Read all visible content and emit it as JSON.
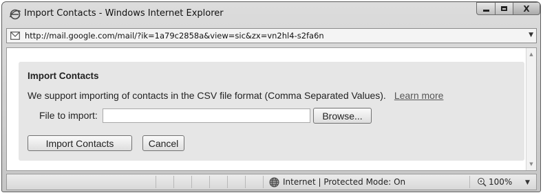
{
  "window": {
    "title": "Import Contacts - Windows Internet Explorer",
    "controls": {
      "minimize_icon": "minimize-icon",
      "maximize_icon": "maximize-icon",
      "close_icon": "close-icon",
      "close_glyph": "X"
    }
  },
  "addressbar": {
    "icon": "mail-icon",
    "url": "http://mail.google.com/mail/?ik=1a79c2858a&view=sic&zx=vn2hl4-s2fa6n",
    "dropdown_glyph": "▼"
  },
  "dialog": {
    "title": "Import Contacts",
    "description": "We support importing of contacts in the CSV file format (Comma Separated Values).",
    "learn_more": "Learn more",
    "file_label": "File to import:",
    "file_value": "",
    "browse_label": "Browse...",
    "import_label": "Import Contacts",
    "cancel_label": "Cancel"
  },
  "scrollbar": {
    "up_glyph": "▲",
    "down_glyph": "▼"
  },
  "statusbar": {
    "zone_icon": "globe-icon",
    "zone_text": "Internet | Protected Mode: On",
    "zoom_icon": "zoom-magnifier-icon",
    "zoom": "100%",
    "zoom_dropdown_glyph": "▼"
  },
  "colors": {
    "panel_background": "#e6e6e6",
    "link": "#555555",
    "frame": "#c6c6c6"
  }
}
